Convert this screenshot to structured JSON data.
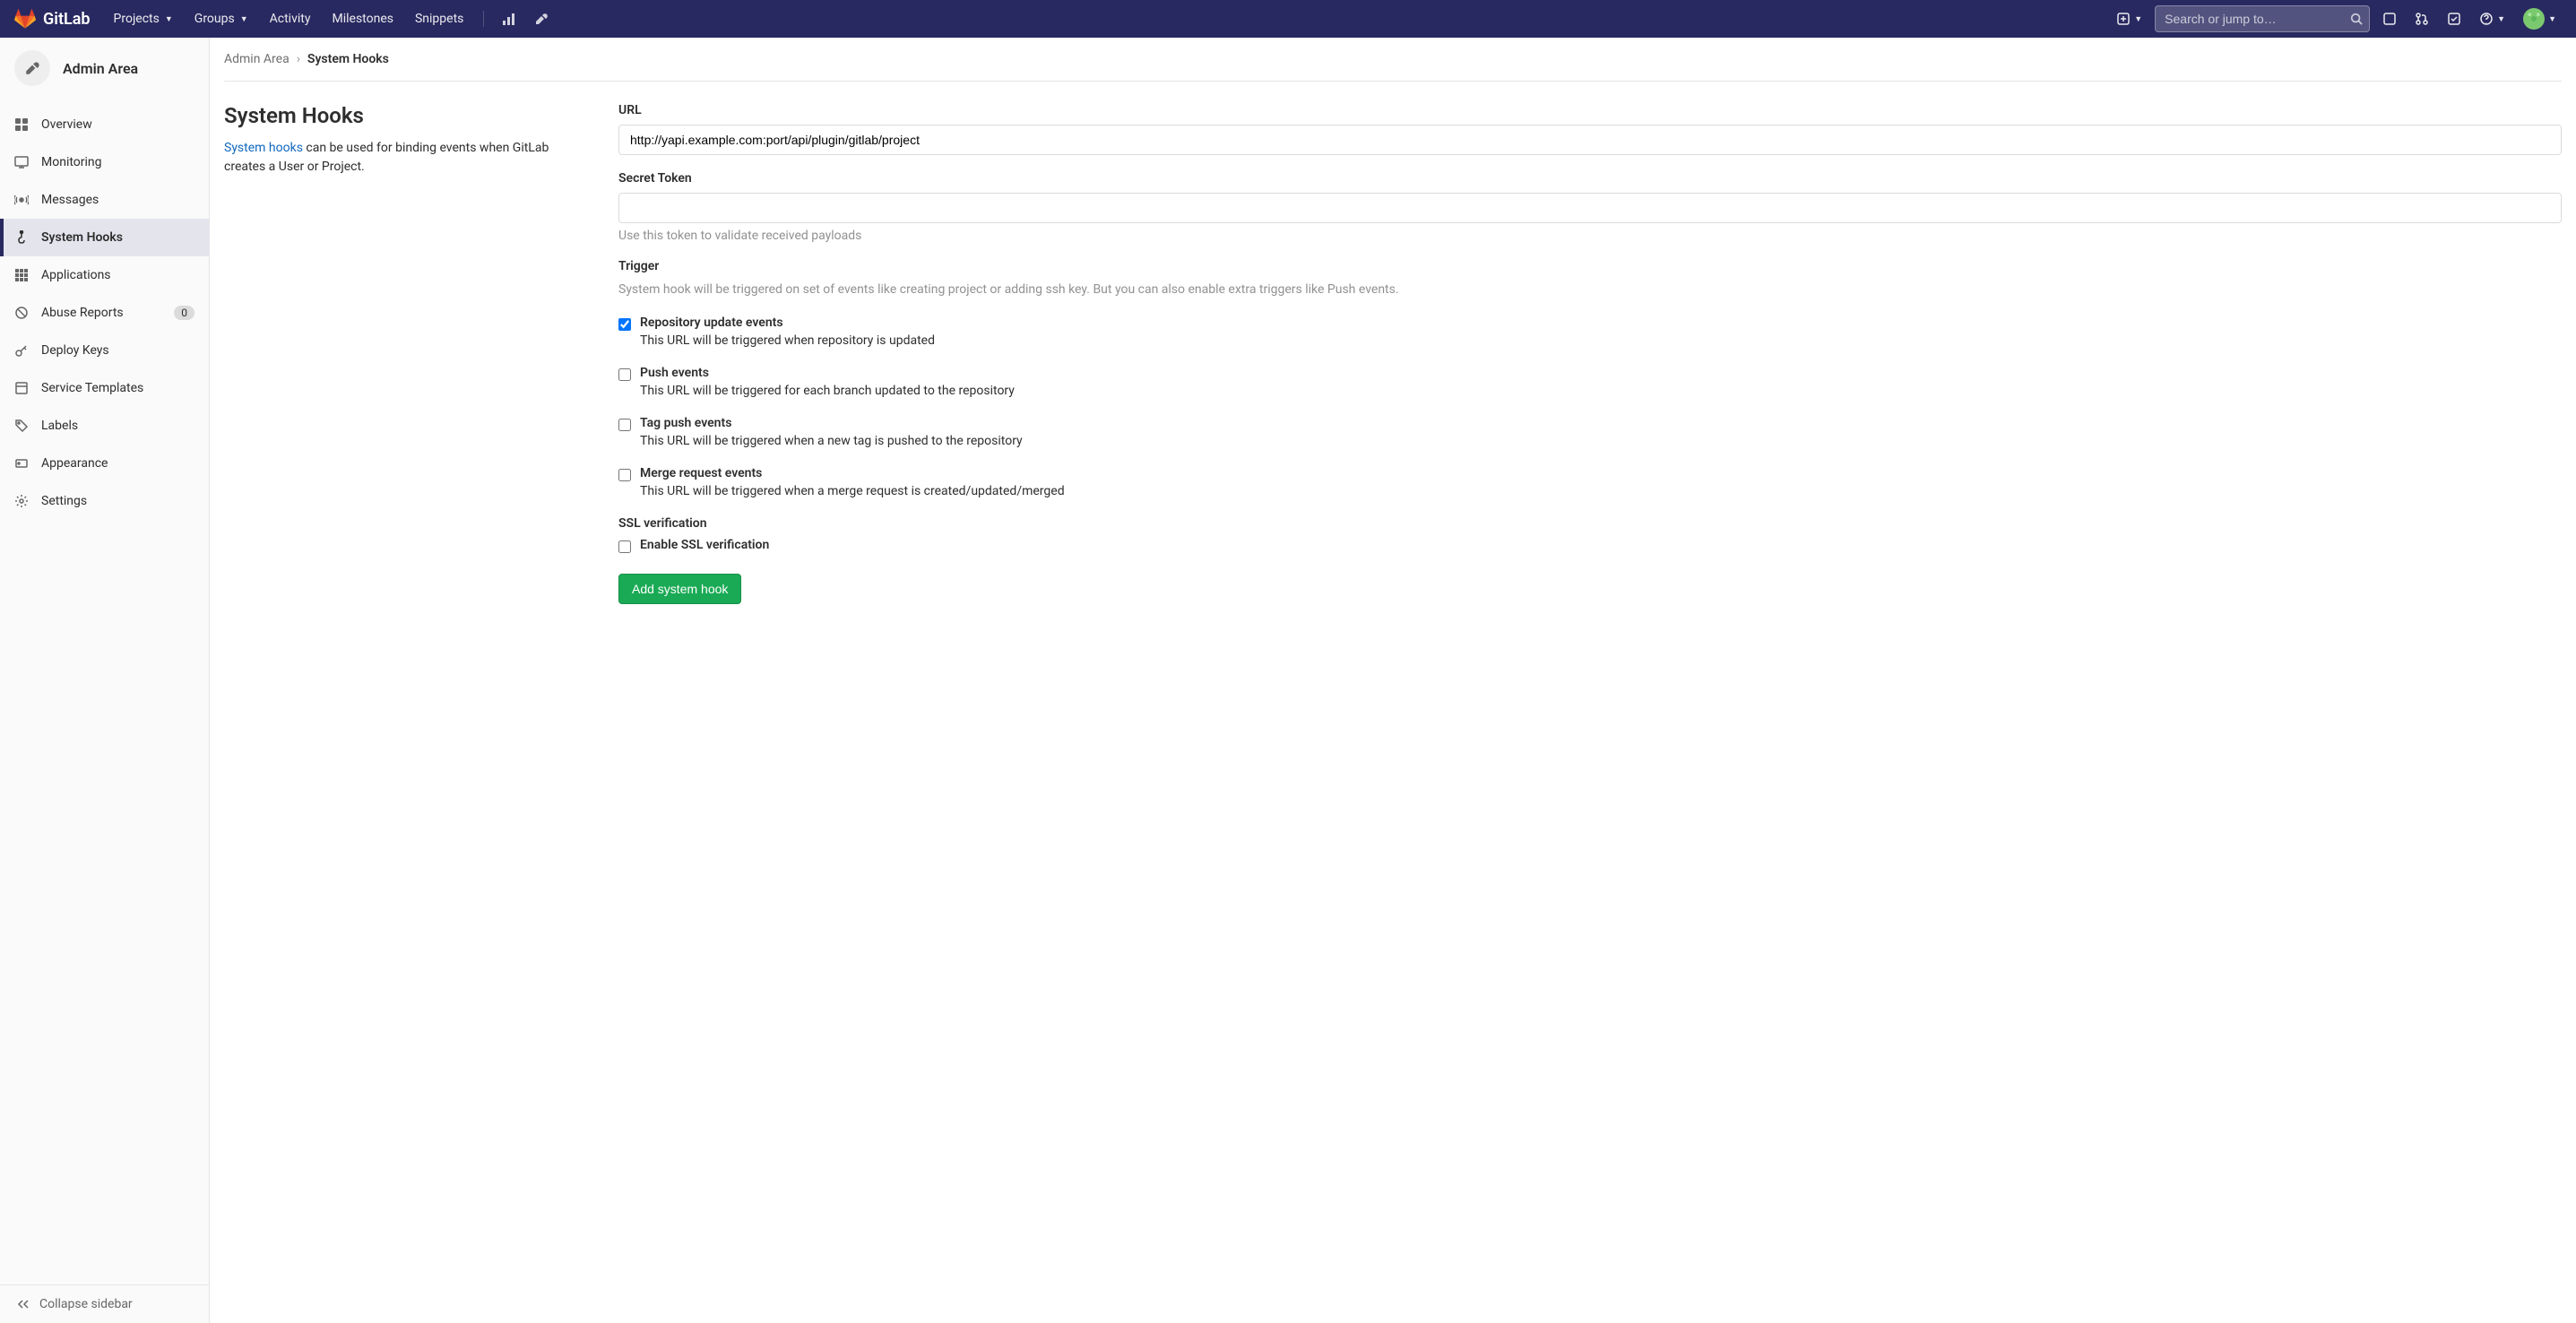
{
  "topnav": {
    "logo_text": "GitLab",
    "projects": "Projects",
    "groups": "Groups",
    "activity": "Activity",
    "milestones": "Milestones",
    "snippets": "Snippets",
    "search_placeholder": "Search or jump to…"
  },
  "sidebar": {
    "title": "Admin Area",
    "items": [
      {
        "label": "Overview"
      },
      {
        "label": "Monitoring"
      },
      {
        "label": "Messages"
      },
      {
        "label": "System Hooks"
      },
      {
        "label": "Applications"
      },
      {
        "label": "Abuse Reports",
        "badge": "0"
      },
      {
        "label": "Deploy Keys"
      },
      {
        "label": "Service Templates"
      },
      {
        "label": "Labels"
      },
      {
        "label": "Appearance"
      },
      {
        "label": "Settings"
      }
    ],
    "collapse": "Collapse sidebar"
  },
  "breadcrumb": {
    "root": "Admin Area",
    "current": "System Hooks"
  },
  "page": {
    "heading": "System Hooks",
    "desc_link": "System hooks",
    "desc_rest": " can be used for binding events when GitLab creates a User or Project."
  },
  "form": {
    "url_label": "URL",
    "url_value": "http://yapi.example.com:port/api/plugin/gitlab/project",
    "secret_label": "Secret Token",
    "secret_help": "Use this token to validate received payloads",
    "trigger_label": "Trigger",
    "trigger_desc": "System hook will be triggered on set of events like creating project or adding ssh key. But you can also enable extra triggers like Push events.",
    "triggers": [
      {
        "label": "Repository update events",
        "desc": "This URL will be triggered when repository is updated",
        "checked": true
      },
      {
        "label": "Push events",
        "desc": "This URL will be triggered for each branch updated to the repository",
        "checked": false
      },
      {
        "label": "Tag push events",
        "desc": "This URL will be triggered when a new tag is pushed to the repository",
        "checked": false
      },
      {
        "label": "Merge request events",
        "desc": "This URL will be triggered when a merge request is created/updated/merged",
        "checked": false
      }
    ],
    "ssl_label": "SSL verification",
    "ssl_checkbox": "Enable SSL verification",
    "submit": "Add system hook"
  }
}
